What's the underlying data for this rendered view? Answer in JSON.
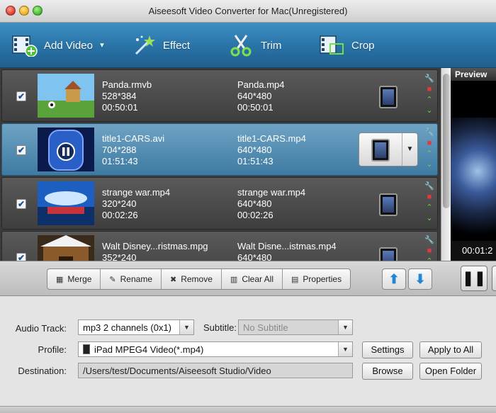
{
  "window": {
    "title": "Aiseesoft Video Converter for Mac(Unregistered)"
  },
  "toolbar": {
    "add_video": "Add Video",
    "effect": "Effect",
    "trim": "Trim",
    "crop": "Crop"
  },
  "files": [
    {
      "checked": true,
      "src_name": "Panda.rmvb",
      "src_res": "528*384",
      "src_dur": "00:50:01",
      "dst_name": "Panda.mp4",
      "dst_res": "640*480",
      "dst_dur": "00:50:01",
      "thumb_icon": "panda-scene-thumbnail"
    },
    {
      "checked": true,
      "selected": true,
      "src_name": "title1-CARS.avi",
      "src_res": "704*288",
      "src_dur": "01:51:43",
      "dst_name": "title1-CARS.mp4",
      "dst_res": "640*480",
      "dst_dur": "01:51:43",
      "thumb_icon": "cars-door-thumbnail"
    },
    {
      "checked": true,
      "src_name": "strange war.mp4",
      "src_res": "320*240",
      "src_dur": "00:02:26",
      "dst_name": "strange war.mp4",
      "dst_res": "640*480",
      "dst_dur": "00:02:26",
      "thumb_icon": "dreamworks-thumbnail"
    },
    {
      "checked": true,
      "src_name": "Walt Disney...ristmas.mpg",
      "src_res": "352*240",
      "src_dur": "",
      "dst_name": "Walt Disne...istmas.mp4",
      "dst_res": "640*480",
      "dst_dur": "",
      "thumb_icon": "snow-house-thumbnail"
    }
  ],
  "preview": {
    "label": "Preview",
    "time": "00:01:2"
  },
  "actions": {
    "merge": "Merge",
    "rename": "Rename",
    "remove": "Remove",
    "clear_all": "Clear All",
    "properties": "Properties"
  },
  "settings": {
    "audio_track_label": "Audio Track:",
    "audio_track_value": "mp3 2 channels (0x1)",
    "subtitle_label": "Subtitle:",
    "subtitle_value": "No Subtitle",
    "profile_label": "Profile:",
    "profile_value": "iPad MPEG4 Video(*.mp4)",
    "destination_label": "Destination:",
    "destination_value": "/Users/test/Documents/Aiseesoft Studio/Video",
    "settings_btn": "Settings",
    "apply_all_btn": "Apply to All",
    "browse_btn": "Browse",
    "open_folder_btn": "Open Folder"
  },
  "colors": {
    "toolbar": "#2a74a8",
    "selected_row": "#4f8cb3",
    "row": "#4a4a4a"
  }
}
